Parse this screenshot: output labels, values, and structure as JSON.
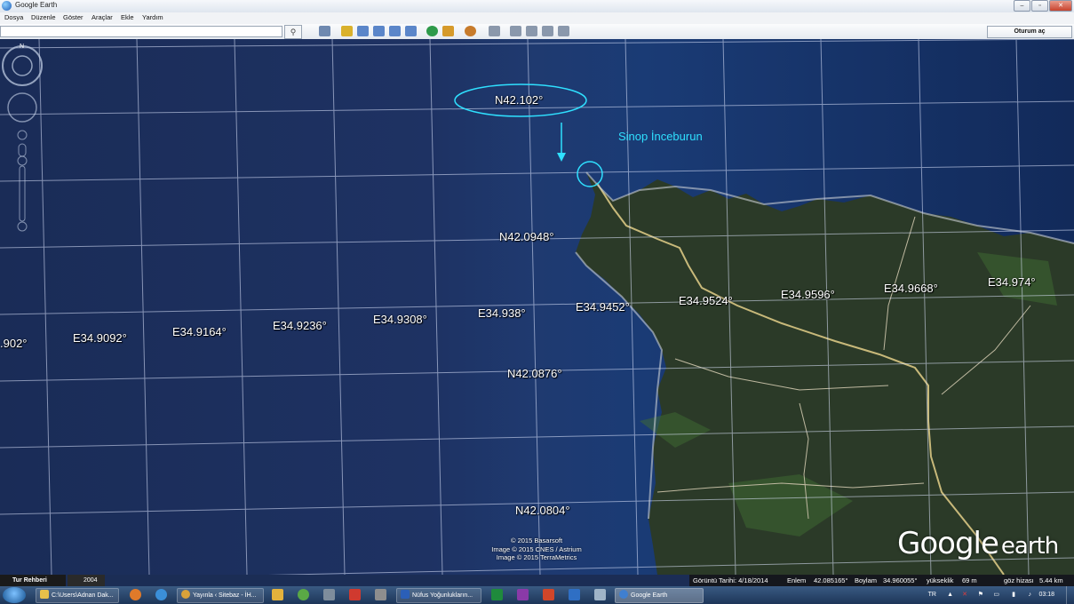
{
  "window": {
    "title": "Google Earth",
    "minimize": "–",
    "maximize": "▫",
    "close": "✕"
  },
  "menu": [
    "Dosya",
    "Düzenle",
    "Göster",
    "Araçlar",
    "Ekle",
    "Yardım"
  ],
  "toolbar": {
    "search_value": "",
    "signin_label": "Oturum aç"
  },
  "map": {
    "place_label": "Sinop İnceburun",
    "latitude_labels": [
      "N42.102°",
      "N42.0948°",
      "N42.0876°",
      "N42.0804°"
    ],
    "longitude_labels": [
      ".902°",
      "E34.9092°",
      "E34.9164°",
      "E34.9236°",
      "E34.9308°",
      "E34.938°",
      "E34.9452°",
      "E34.9524°",
      "E34.9596°",
      "E34.9668°",
      "E34.974°"
    ],
    "credits": [
      "© 2015 Basarsoft",
      "Image © 2015 CNES / Astrium",
      "Image © 2015 TerraMetrics"
    ],
    "logo": {
      "main": "Google",
      "sub": "earth"
    },
    "colors": {
      "sea": "#1b2d55",
      "land": "#2b3a28",
      "annotation": "#2fe0ff"
    }
  },
  "bottom": {
    "tour_label": "Tur Rehberi",
    "year": "2004"
  },
  "status": {
    "imagery_date": "Görüntü Tarihi: 4/18/2014",
    "lat_label": "Enlem",
    "lat_value": "42.085165°",
    "lon_label": "Boylam",
    "lon_value": "34.960055°",
    "elev_label": "yükseklik",
    "elev_value": "69 m",
    "eye_label": "göz hizası",
    "eye_value": "5.44 km"
  },
  "taskbar": {
    "tasks": [
      "C:\\Users\\Adnan Dak...",
      "Yayınla ‹ Sitebaz - İH...",
      "Nüfus Yoğunlukların...",
      "Google Earth"
    ],
    "language": "TR",
    "clock": "03:18"
  }
}
